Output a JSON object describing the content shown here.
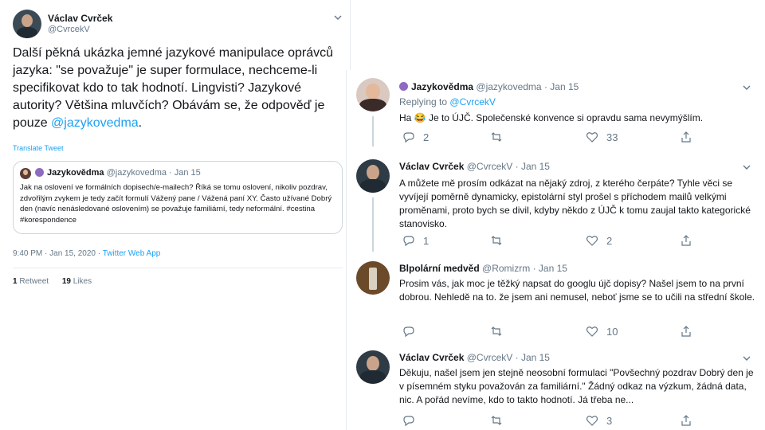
{
  "main_tweet": {
    "author_name": "Václav Cvrček",
    "author_handle": "@CvrcekV",
    "text": "Další pěkná ukázka jemné jazykové manipulace oprávců jazyka: \"se považuje\" je super formulace, nechceme-li specifikovat kdo to tak hodnotí. Lingvisti? Jazykové autority? Většina mluvčích? Obávám se, že odpověď je pouze ",
    "mention": "@jazykovedma",
    "text_end": ".",
    "translate": "Translate Tweet",
    "quoted": {
      "author_name": "Jazykovědma",
      "author_handle": "@jazykovedma",
      "date": "· Jan 15",
      "text": "Jak na oslovení ve formálních dopisech/e-mailech? Říká se tomu oslovení, nikoliv pozdrav, zdvořilým zvykem je tedy začít formulí Vážený pane / Vážená paní XY. Často užívané Dobrý den (navíc nenásledované oslovením) se považuje familiární, tedy neformální. #cestina #korespondence"
    },
    "time": "9:40 PM · Jan 15, 2020 ·",
    "source": "Twitter Web App",
    "retweets_count": "1",
    "retweets_label": "Retweet",
    "likes_count": "19",
    "likes_label": "Likes"
  },
  "replies": [
    {
      "author_name": "Jazykovědma",
      "author_handle": "@jazykovedma",
      "date": "· Jan 15",
      "replying_to_label": "Replying to",
      "replying_to": "@CvrcekV",
      "text": "Ha 😂 Je to ÚJČ. Společenské konvence si opravdu sama nevymýšlím.",
      "replies": "2",
      "retweets": "",
      "likes": "33"
    },
    {
      "author_name": "Václav Cvrček",
      "author_handle": "@CvrcekV",
      "date": "· Jan 15",
      "text": "A můžete mě prosím odkázat na nějaký zdroj, z kterého čerpáte? Tyhle věci se vyvíjejí poměrně dynamicky, epistolární styl prošel s příchodem mailů velkými proměnami, proto bych se divil, kdyby někdo z ÚJČ k tomu zaujal takto kategorické stanovisko.",
      "replies": "1",
      "retweets": "",
      "likes": "2"
    },
    {
      "author_name": "Blpolární medvěd",
      "author_handle": "@Romizrm",
      "date": "· Jan 15",
      "text": "Prosim vás, jak moc je těžký napsat do googlu újč dopisy? Našel jsem to na první dobrou. Nehledě na to. že jsem ani nemusel, neboť jsme se to učili na střední škole.",
      "replies": "",
      "retweets": "",
      "likes": "10"
    },
    {
      "author_name": "Václav Cvrček",
      "author_handle": "@CvrcekV",
      "date": "· Jan 15",
      "text": "Děkuju, našel jsem jen stejně neosobní formulaci \"Povšechný pozdrav Dobrý den je v písemném styku považován za familiární.\" Žádný odkaz na výzkum, žádná data, nic. A pořád nevíme, kdo to takto hodnotí. Já třeba ne...",
      "replies": "",
      "retweets": "",
      "likes": "3"
    }
  ],
  "icons": {
    "reply": "reply-icon",
    "retweet": "retweet-icon",
    "like": "heart-icon",
    "share": "share-icon",
    "chevron": "chevron-down-icon"
  }
}
